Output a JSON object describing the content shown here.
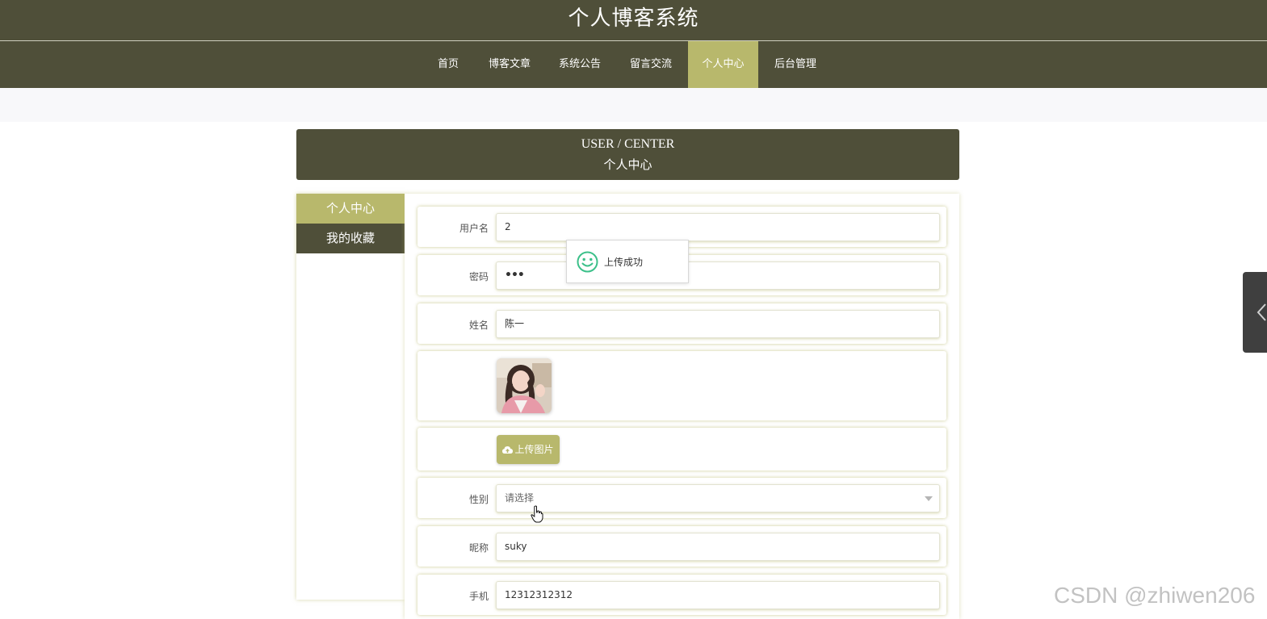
{
  "header": {
    "site_title": "个人博客系统",
    "nav": [
      {
        "label": "首页",
        "active": false
      },
      {
        "label": "博客文章",
        "active": false
      },
      {
        "label": "系统公告",
        "active": false
      },
      {
        "label": "留言交流",
        "active": false
      },
      {
        "label": "个人中心",
        "active": true
      },
      {
        "label": "后台管理",
        "active": false
      }
    ]
  },
  "banner": {
    "en": "USER / CENTER",
    "cn": "个人中心"
  },
  "sidebar": {
    "items": [
      {
        "label": "个人中心",
        "active": true
      },
      {
        "label": "我的收藏",
        "active": false
      }
    ]
  },
  "form": {
    "username": {
      "label": "用户名",
      "value": "2"
    },
    "password": {
      "label": "密码",
      "value": "•••"
    },
    "name": {
      "label": "姓名",
      "value": "陈一"
    },
    "upload": {
      "label": "上传图片",
      "icon": "cloud-upload-icon"
    },
    "gender": {
      "label": "性别",
      "placeholder": "请选择"
    },
    "nickname": {
      "label": "昵称",
      "value": "suky"
    },
    "phone": {
      "label": "手机",
      "value": "12312312312"
    }
  },
  "toast": {
    "message": "上传成功",
    "icon": "smile-icon"
  },
  "watermark": "CSDN @zhiwen206",
  "colors": {
    "primary_dark": "#4f4f39",
    "accent": "#b8b86c",
    "success_icon": "#3cc08a"
  }
}
